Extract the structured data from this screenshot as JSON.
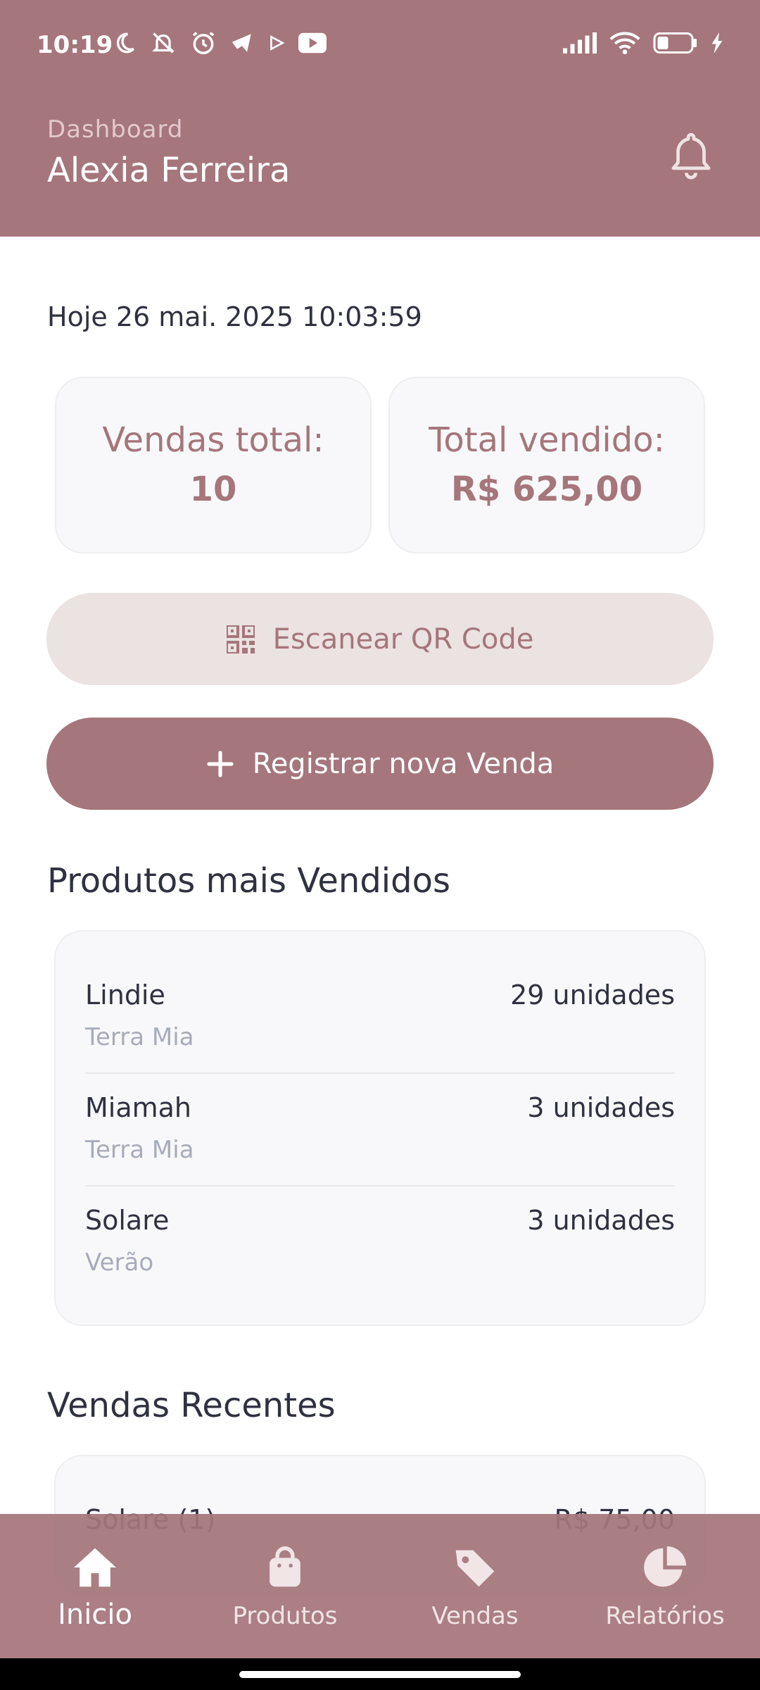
{
  "status_bar": {
    "time": "10:19",
    "left_icons": [
      "moon-icon",
      "muted-bell-icon",
      "alarm-icon",
      "telegram-icon",
      "play-icon",
      "youtube-icon"
    ],
    "right_icons": [
      "signal-icon",
      "wifi-icon",
      "battery-icon",
      "charging-icon"
    ],
    "battery_level": "1"
  },
  "header": {
    "subtitle": "Dashboard",
    "title": "Alexia Ferreira",
    "icon": "bell-icon"
  },
  "datetime": "Hoje 26 mai. 2025 10:03:59",
  "stats": {
    "sales_count_label": "Vendas total:",
    "sales_count_value": "10",
    "sales_total_label": "Total vendido:",
    "sales_total_value": "R$ 625,00"
  },
  "actions": {
    "scan_label": "Escanear QR Code",
    "new_sale_label": "Registrar nova Venda"
  },
  "top_products": {
    "title": "Produtos mais Vendidos",
    "items": [
      {
        "name": "Lindie",
        "units": "29 unidades",
        "category": "Terra Mia"
      },
      {
        "name": "Miamah",
        "units": "3 unidades",
        "category": "Terra Mia"
      },
      {
        "name": "Solare",
        "units": "3 unidades",
        "category": "Verão"
      }
    ]
  },
  "recent_sales": {
    "title": "Vendas Recentes",
    "peek_left": "Solare (1)",
    "peek_right": "R$ 75,00"
  },
  "nav": {
    "items": [
      {
        "label": "Inicio",
        "icon": "home-icon",
        "active": true
      },
      {
        "label": "Produtos",
        "icon": "shopping-bag-icon",
        "active": false
      },
      {
        "label": "Vendas",
        "icon": "tag-icon",
        "active": false
      },
      {
        "label": "Relatórios",
        "icon": "pie-chart-icon",
        "active": false
      }
    ]
  },
  "colors": {
    "primary": "#a5767b",
    "primary_light": "#ebe2e2",
    "text_dark": "#2f3140",
    "text_muted": "#a7abba",
    "card_bg": "#f8f8fa"
  }
}
